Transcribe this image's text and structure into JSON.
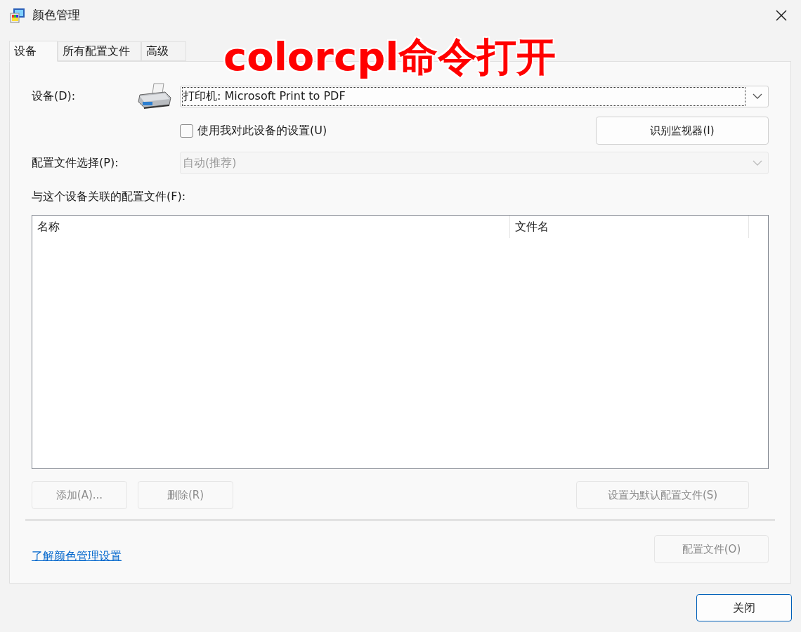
{
  "window": {
    "title": "颜色管理"
  },
  "annotation": "colorcpl命令打开",
  "tabs": [
    {
      "label": "设备",
      "selected": true
    },
    {
      "label": "所有配置文件",
      "selected": false
    },
    {
      "label": "高级",
      "selected": false
    }
  ],
  "device": {
    "label": "设备(D):",
    "value": "打印机: Microsoft Print to PDF"
  },
  "use_my_settings": {
    "label": "使用我对此设备的设置(U)",
    "checked": false
  },
  "identify_button": {
    "label": "识别监视器(I)",
    "disabled": false
  },
  "profile_selection": {
    "label": "配置文件选择(P):",
    "value": "自动(推荐)",
    "disabled": true
  },
  "profiles_label": "与这个设备关联的配置文件(F):",
  "table": {
    "columns": [
      "名称",
      "文件名"
    ]
  },
  "list_buttons": [
    {
      "label": "添加(A)...",
      "disabled": true
    },
    {
      "label": "删除(R)",
      "disabled": true
    },
    {
      "label": "设置为默认配置文件(S)",
      "disabled": true
    }
  ],
  "learn_link": "了解颜色管理设置",
  "profiles_button": {
    "label": "配置文件(O)",
    "disabled": true
  },
  "close_button": {
    "label": "关闭"
  }
}
